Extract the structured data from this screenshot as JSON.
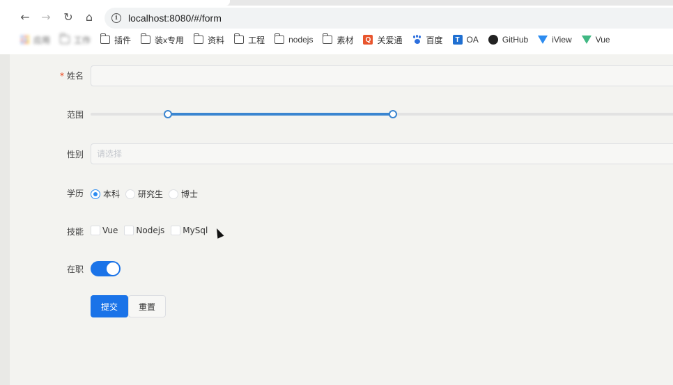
{
  "browser": {
    "url": "localhost:8080/#/form",
    "bookmarks": [
      {
        "label": "应用",
        "icon": "apps-icon"
      },
      {
        "label": "工作",
        "icon": "folder-icon"
      },
      {
        "label": "插件",
        "icon": "folder-icon"
      },
      {
        "label": "装x专用",
        "icon": "folder-icon"
      },
      {
        "label": "资料",
        "icon": "folder-icon"
      },
      {
        "label": "工程",
        "icon": "folder-icon"
      },
      {
        "label": "nodejs",
        "icon": "folder-icon"
      },
      {
        "label": "素材",
        "icon": "folder-icon"
      },
      {
        "label": "关爱通",
        "icon": "guanaitong-icon"
      },
      {
        "label": "百度",
        "icon": "baidu-paw-icon"
      },
      {
        "label": "OA",
        "icon": "oa-icon"
      },
      {
        "label": "GitHub",
        "icon": "github-icon"
      },
      {
        "label": "iView",
        "icon": "iview-icon"
      },
      {
        "label": "Vue",
        "icon": "vue-icon"
      }
    ]
  },
  "form": {
    "name": {
      "label": "姓名",
      "required_mark": "*",
      "value": ""
    },
    "range": {
      "label": "范围",
      "min": 0,
      "max": 100,
      "low": 13,
      "high": 51
    },
    "gender": {
      "label": "性别",
      "placeholder": "请选择"
    },
    "education": {
      "label": "学历",
      "options": [
        "本科",
        "研究生",
        "博士"
      ],
      "selected": "本科"
    },
    "skills": {
      "label": "技能",
      "options": [
        "Vue",
        "Nodejs",
        "MySql"
      ],
      "checked": []
    },
    "employed": {
      "label": "在职",
      "on": true
    },
    "submit_label": "提交",
    "reset_label": "重置"
  },
  "colors": {
    "primary": "#1a73e8",
    "slider": "#3a85d0",
    "required": "#ed4014"
  }
}
